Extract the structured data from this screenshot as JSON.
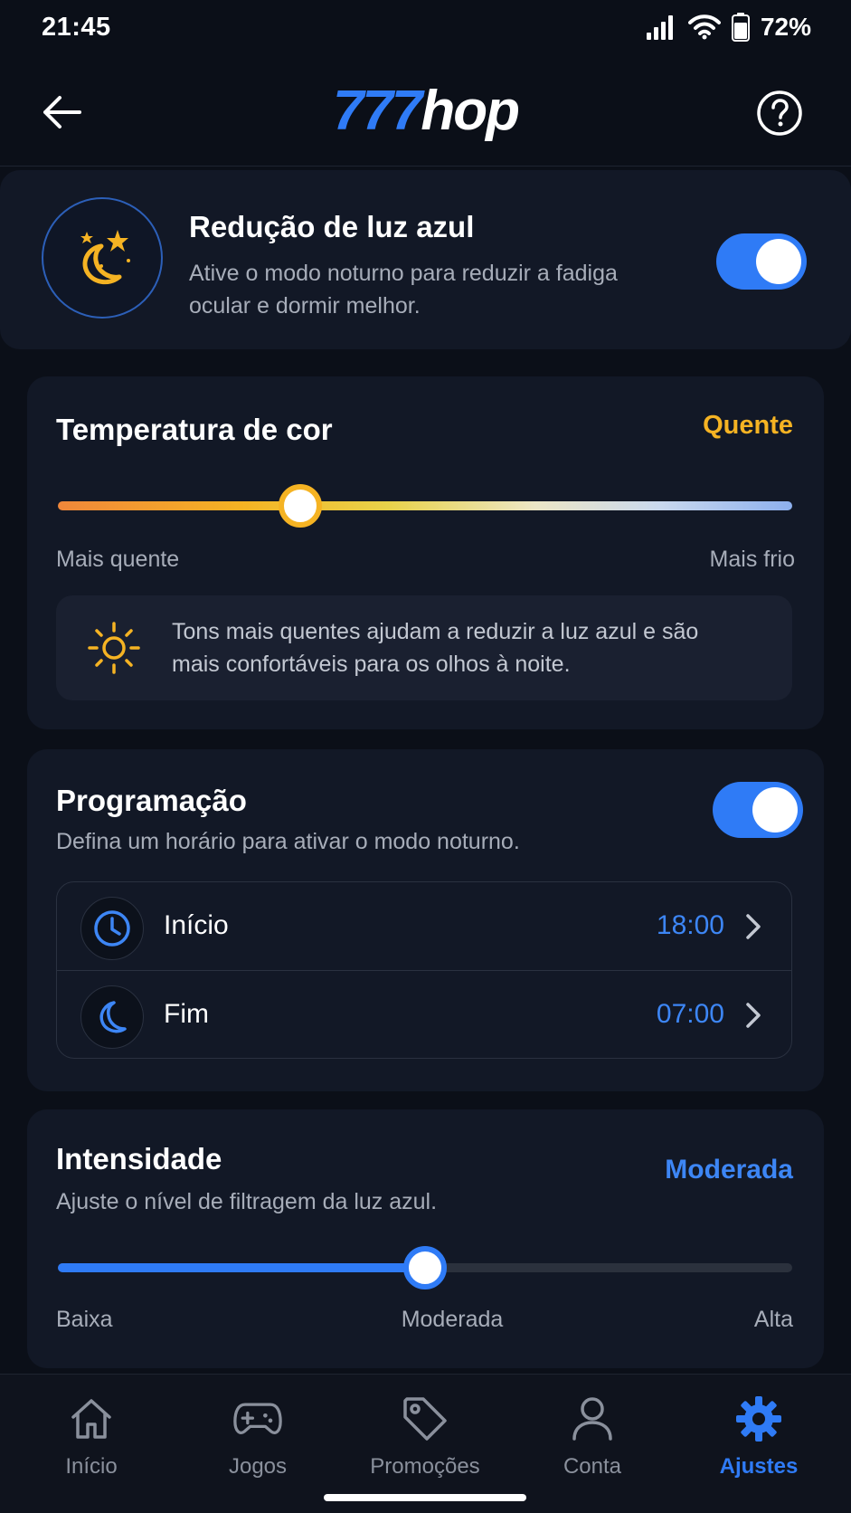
{
  "status_bar": {
    "time": "21:45",
    "battery": "72%",
    "icons": [
      "signal-icon",
      "wifi-icon",
      "battery-icon"
    ]
  },
  "app_bar": {
    "logo_number": "777",
    "logo_word": "hop",
    "back_icon": "arrow-left-icon",
    "help_icon": "help-circle-icon"
  },
  "hero": {
    "title": "Redução de luz azul",
    "description": "Ative o modo noturno para reduzir a fadiga ocular e dormir melhor.",
    "enabled": true,
    "icon": "moon-stars-icon"
  },
  "color_temperature": {
    "title": "Temperatura de cor",
    "value_label": "Quente",
    "position": 0.33,
    "min_label": "Mais quente",
    "max_label": "Mais frio",
    "tip_icon": "sun-icon",
    "tip_text": "Tons mais quentes ajudam a reduzir a luz azul e são mais confortáveis para os olhos à noite."
  },
  "schedule": {
    "title": "Programação",
    "subtitle": "Defina um horário para ativar o modo noturno.",
    "enabled": true,
    "rows": [
      {
        "label": "Início",
        "value": "18:00",
        "icon": "clock-icon"
      },
      {
        "label": "Fim",
        "value": "07:00",
        "icon": "moon-icon"
      }
    ]
  },
  "intensity": {
    "title": "Intensidade",
    "subtitle": "Ajuste o nível de filtragem da luz azul.",
    "value_label": "Moderada",
    "position": 0.5,
    "labels": [
      "Baixa",
      "Moderada",
      "Alta"
    ]
  },
  "bottom_nav": {
    "items": [
      {
        "label": "Início",
        "icon": "home-icon",
        "active": false
      },
      {
        "label": "Jogos",
        "icon": "gamepad-icon",
        "active": false
      },
      {
        "label": "Promoções",
        "icon": "tag-icon",
        "active": false
      },
      {
        "label": "Conta",
        "icon": "user-icon",
        "active": false
      },
      {
        "label": "Ajustes",
        "icon": "gear-icon",
        "active": true
      }
    ]
  },
  "colors": {
    "accent": "#2f7bf6",
    "warm": "#f5b323",
    "background": "#0b0f18",
    "card": "#121826"
  }
}
